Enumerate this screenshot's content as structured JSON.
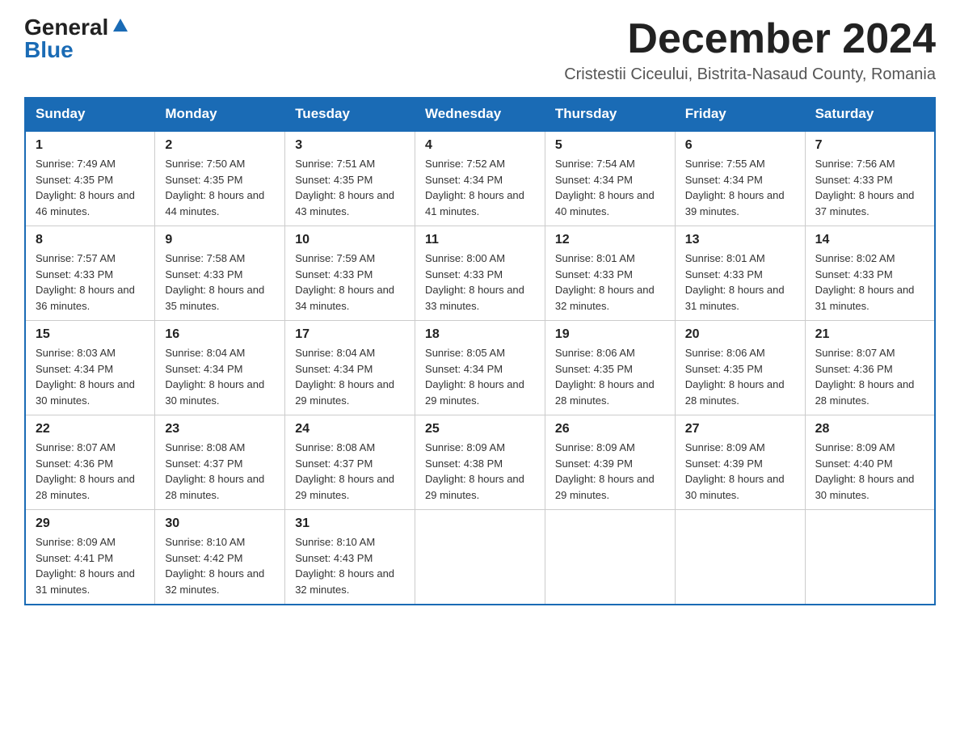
{
  "header": {
    "logo_general": "General",
    "logo_blue": "Blue",
    "month_title": "December 2024",
    "subtitle": "Cristestii Ciceului, Bistrita-Nasaud County, Romania"
  },
  "weekdays": [
    "Sunday",
    "Monday",
    "Tuesday",
    "Wednesday",
    "Thursday",
    "Friday",
    "Saturday"
  ],
  "weeks": [
    [
      {
        "day": "1",
        "sunrise": "7:49 AM",
        "sunset": "4:35 PM",
        "daylight": "8 hours and 46 minutes."
      },
      {
        "day": "2",
        "sunrise": "7:50 AM",
        "sunset": "4:35 PM",
        "daylight": "8 hours and 44 minutes."
      },
      {
        "day": "3",
        "sunrise": "7:51 AM",
        "sunset": "4:35 PM",
        "daylight": "8 hours and 43 minutes."
      },
      {
        "day": "4",
        "sunrise": "7:52 AM",
        "sunset": "4:34 PM",
        "daylight": "8 hours and 41 minutes."
      },
      {
        "day": "5",
        "sunrise": "7:54 AM",
        "sunset": "4:34 PM",
        "daylight": "8 hours and 40 minutes."
      },
      {
        "day": "6",
        "sunrise": "7:55 AM",
        "sunset": "4:34 PM",
        "daylight": "8 hours and 39 minutes."
      },
      {
        "day": "7",
        "sunrise": "7:56 AM",
        "sunset": "4:33 PM",
        "daylight": "8 hours and 37 minutes."
      }
    ],
    [
      {
        "day": "8",
        "sunrise": "7:57 AM",
        "sunset": "4:33 PM",
        "daylight": "8 hours and 36 minutes."
      },
      {
        "day": "9",
        "sunrise": "7:58 AM",
        "sunset": "4:33 PM",
        "daylight": "8 hours and 35 minutes."
      },
      {
        "day": "10",
        "sunrise": "7:59 AM",
        "sunset": "4:33 PM",
        "daylight": "8 hours and 34 minutes."
      },
      {
        "day": "11",
        "sunrise": "8:00 AM",
        "sunset": "4:33 PM",
        "daylight": "8 hours and 33 minutes."
      },
      {
        "day": "12",
        "sunrise": "8:01 AM",
        "sunset": "4:33 PM",
        "daylight": "8 hours and 32 minutes."
      },
      {
        "day": "13",
        "sunrise": "8:01 AM",
        "sunset": "4:33 PM",
        "daylight": "8 hours and 31 minutes."
      },
      {
        "day": "14",
        "sunrise": "8:02 AM",
        "sunset": "4:33 PM",
        "daylight": "8 hours and 31 minutes."
      }
    ],
    [
      {
        "day": "15",
        "sunrise": "8:03 AM",
        "sunset": "4:34 PM",
        "daylight": "8 hours and 30 minutes."
      },
      {
        "day": "16",
        "sunrise": "8:04 AM",
        "sunset": "4:34 PM",
        "daylight": "8 hours and 30 minutes."
      },
      {
        "day": "17",
        "sunrise": "8:04 AM",
        "sunset": "4:34 PM",
        "daylight": "8 hours and 29 minutes."
      },
      {
        "day": "18",
        "sunrise": "8:05 AM",
        "sunset": "4:34 PM",
        "daylight": "8 hours and 29 minutes."
      },
      {
        "day": "19",
        "sunrise": "8:06 AM",
        "sunset": "4:35 PM",
        "daylight": "8 hours and 28 minutes."
      },
      {
        "day": "20",
        "sunrise": "8:06 AM",
        "sunset": "4:35 PM",
        "daylight": "8 hours and 28 minutes."
      },
      {
        "day": "21",
        "sunrise": "8:07 AM",
        "sunset": "4:36 PM",
        "daylight": "8 hours and 28 minutes."
      }
    ],
    [
      {
        "day": "22",
        "sunrise": "8:07 AM",
        "sunset": "4:36 PM",
        "daylight": "8 hours and 28 minutes."
      },
      {
        "day": "23",
        "sunrise": "8:08 AM",
        "sunset": "4:37 PM",
        "daylight": "8 hours and 28 minutes."
      },
      {
        "day": "24",
        "sunrise": "8:08 AM",
        "sunset": "4:37 PM",
        "daylight": "8 hours and 29 minutes."
      },
      {
        "day": "25",
        "sunrise": "8:09 AM",
        "sunset": "4:38 PM",
        "daylight": "8 hours and 29 minutes."
      },
      {
        "day": "26",
        "sunrise": "8:09 AM",
        "sunset": "4:39 PM",
        "daylight": "8 hours and 29 minutes."
      },
      {
        "day": "27",
        "sunrise": "8:09 AM",
        "sunset": "4:39 PM",
        "daylight": "8 hours and 30 minutes."
      },
      {
        "day": "28",
        "sunrise": "8:09 AM",
        "sunset": "4:40 PM",
        "daylight": "8 hours and 30 minutes."
      }
    ],
    [
      {
        "day": "29",
        "sunrise": "8:09 AM",
        "sunset": "4:41 PM",
        "daylight": "8 hours and 31 minutes."
      },
      {
        "day": "30",
        "sunrise": "8:10 AM",
        "sunset": "4:42 PM",
        "daylight": "8 hours and 32 minutes."
      },
      {
        "day": "31",
        "sunrise": "8:10 AM",
        "sunset": "4:43 PM",
        "daylight": "8 hours and 32 minutes."
      },
      null,
      null,
      null,
      null
    ]
  ]
}
